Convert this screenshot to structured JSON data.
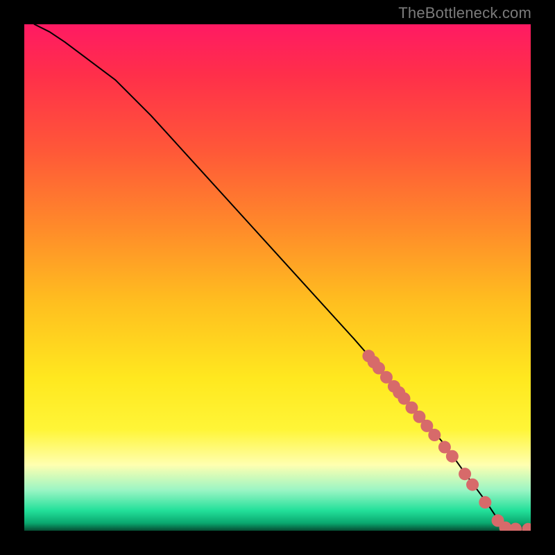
{
  "attribution": "TheBottleneck.com",
  "chart_data": {
    "type": "line",
    "title": "",
    "xlabel": "",
    "ylabel": "",
    "xlim": [
      0,
      100
    ],
    "ylim": [
      0,
      100
    ],
    "grid": false,
    "curve": {
      "name": "main-curve",
      "x": [
        2,
        5,
        8,
        12,
        18,
        25,
        35,
        45,
        55,
        65,
        72,
        78,
        83,
        88,
        91,
        93,
        95,
        97,
        99,
        100
      ],
      "y": [
        100,
        98.5,
        96.5,
        93.5,
        89,
        82,
        71,
        60,
        49,
        38,
        30,
        23,
        17,
        10,
        6,
        3,
        1.2,
        0.5,
        0.3,
        0.3
      ]
    },
    "highlight_points": {
      "name": "data-points",
      "color": "#d76a6a",
      "radius_px": 9,
      "x": [
        68,
        69,
        70,
        71.5,
        73,
        74,
        75,
        76.5,
        78,
        79.5,
        81,
        83,
        84.5,
        87,
        88.5,
        91,
        93.5,
        95,
        97,
        99.5
      ],
      "y": [
        34.5,
        33.3,
        32.1,
        30.3,
        28.5,
        27.3,
        26.1,
        24.3,
        22.5,
        20.7,
        18.9,
        16.5,
        14.7,
        11.2,
        9.1,
        5.6,
        2.0,
        0.6,
        0.35,
        0.3
      ]
    }
  }
}
